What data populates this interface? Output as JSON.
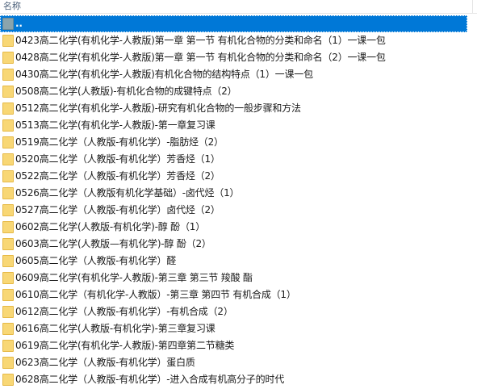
{
  "header": {
    "name_column": "名称"
  },
  "files": [
    {
      "name": "..",
      "type": "parent",
      "selected": true
    },
    {
      "name": "0423高二化学(有机化学-人教版)第一章 第一节 有机化合物的分类和命名（1）一课一包",
      "type": "folder"
    },
    {
      "name": "0428高二化学(有机化学-人教版)第一章 第一节 有机化合物的分类和命名（2）一课一包",
      "type": "folder"
    },
    {
      "name": "0430高二化学(有机化学-人教版)有机化合物的结构特点（1）一课一包",
      "type": "folder"
    },
    {
      "name": "0508高二化学(人教版)-有机化合物的成键特点（2）",
      "type": "folder"
    },
    {
      "name": "0512高二化学(有机化学-人教版)-研究有机化合物的一般步骤和方法",
      "type": "folder"
    },
    {
      "name": "0513高二化学(有机化学-人教版)-第一章复习课",
      "type": "folder"
    },
    {
      "name": "0519高二化学（人教版-有机化学）-脂肪烃（2）",
      "type": "folder"
    },
    {
      "name": "0520高二化学（人教版-有机化学）芳香烃（1）",
      "type": "folder"
    },
    {
      "name": "0522高二化学（人教版-有机化学）芳香烃（2）",
      "type": "folder"
    },
    {
      "name": "0526高二化学（人教版有机化学基础）-卤代烃（1）",
      "type": "folder"
    },
    {
      "name": "0527高二化学（人教版-有机化学）卤代烃（2）",
      "type": "folder"
    },
    {
      "name": "0602高二化学(人教版-有机化学)-醇 酚（1）",
      "type": "folder"
    },
    {
      "name": "0603高二化学(人教版—有机化学)-醇 酚（2）",
      "type": "folder"
    },
    {
      "name": "0605高二化学（人教版-有机化学）醛",
      "type": "folder"
    },
    {
      "name": "0609高二化学(有机化学-人教版)-第三章 第三节 羧酸 酯",
      "type": "folder"
    },
    {
      "name": "0610高二化学（有机化学-人教版）-第三章 第四节 有机合成（1）",
      "type": "folder"
    },
    {
      "name": "0612高二化学（人教版-有机化学）-有机合成（2）",
      "type": "folder"
    },
    {
      "name": "0616高二化学(人教版-有机化学)-第三章复习课",
      "type": "folder"
    },
    {
      "name": "0619高二化学(有机化学-人教版)-第四章第二节糖类",
      "type": "folder"
    },
    {
      "name": "0623高二化学（人教版-有机化学）蛋白质",
      "type": "folder"
    },
    {
      "name": "0628高二化学（人教版-有机化学）-进入合成有机高分子的时代",
      "type": "folder"
    }
  ]
}
